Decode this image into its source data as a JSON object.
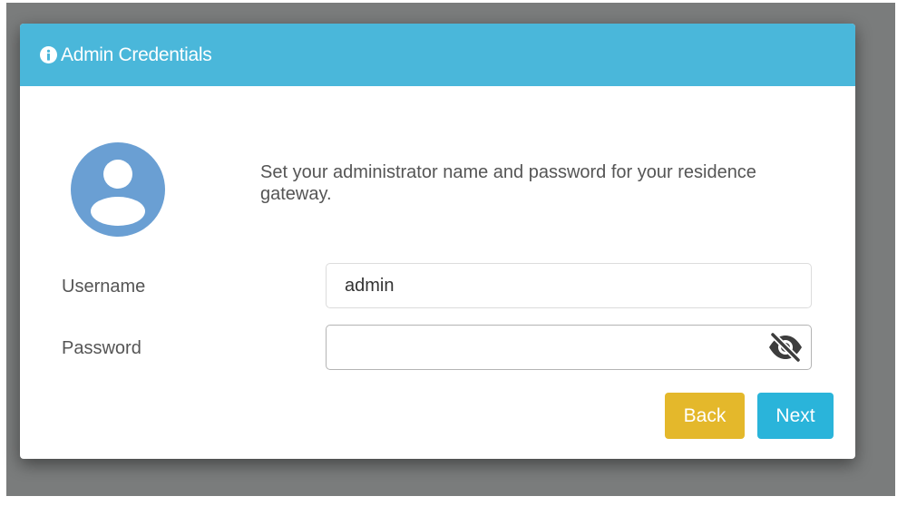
{
  "dialog": {
    "title": "Admin Credentials",
    "icon": "info-icon",
    "description": "Set your administrator name and password for your residence gateway."
  },
  "form": {
    "username": {
      "label": "Username",
      "value": "admin"
    },
    "password": {
      "label": "Password",
      "value": "",
      "toggle_icon": "eye-slash-icon"
    }
  },
  "buttons": {
    "back": "Back",
    "next": "Next"
  },
  "colors": {
    "header": "#4ab7da",
    "back_button": "#e4b82b",
    "next_button": "#2ab4da",
    "avatar": "#6a9fd3",
    "backdrop": "#7a7c7c"
  }
}
